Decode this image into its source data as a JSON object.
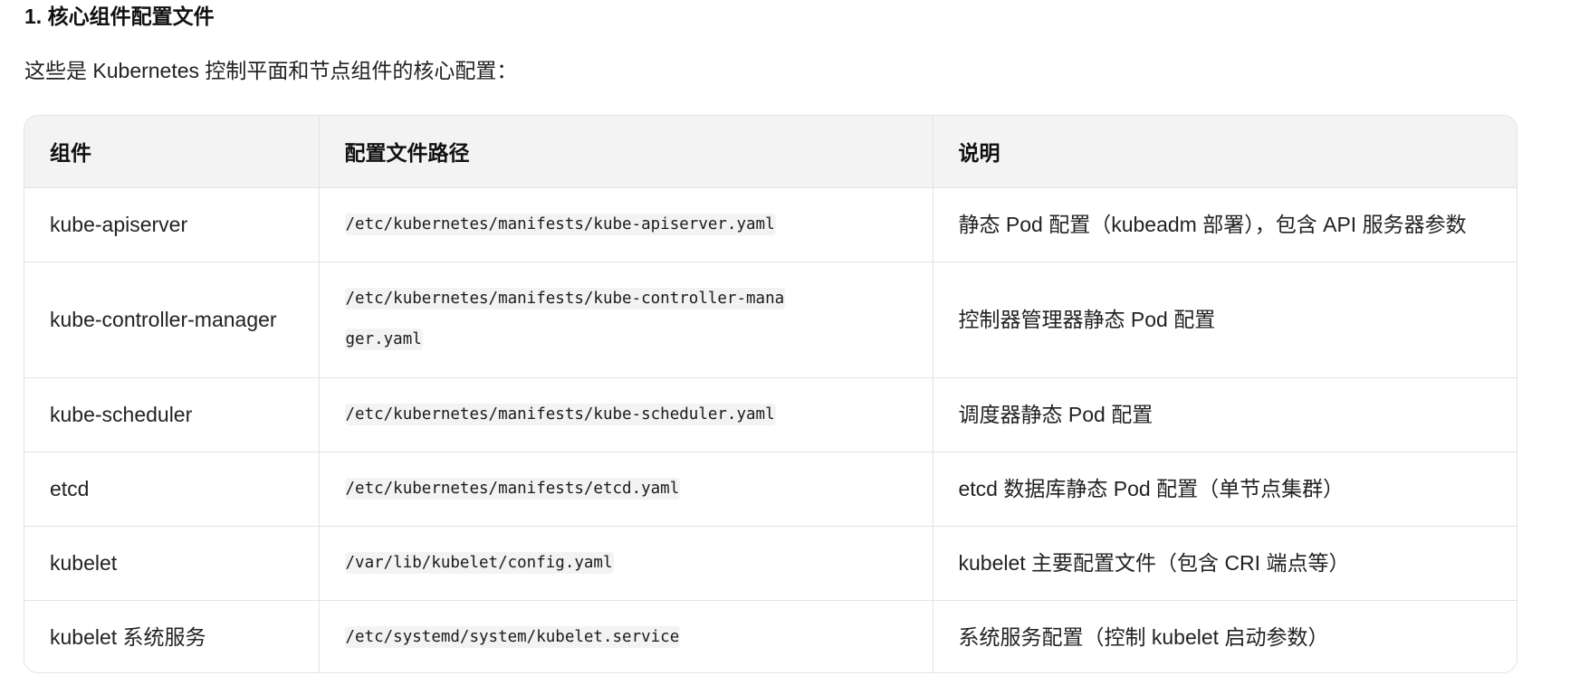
{
  "heading": "1. 核心组件配置文件",
  "intro": "这些是 Kubernetes 控制平面和节点组件的核心配置：",
  "table": {
    "headers": [
      "组件",
      "配置文件路径",
      "说明"
    ],
    "rows": [
      {
        "component": "kube-apiserver",
        "path": "/etc/kubernetes/manifests/kube-apiserver.yaml",
        "desc": "静态 Pod 配置（kubeadm 部署），包含 API 服务器参数"
      },
      {
        "component": "kube-controller-manager",
        "path": "/etc/kubernetes/manifests/kube-controller-manager.yaml",
        "desc": "控制器管理器静态 Pod 配置"
      },
      {
        "component": "kube-scheduler",
        "path": "/etc/kubernetes/manifests/kube-scheduler.yaml",
        "desc": "调度器静态 Pod 配置"
      },
      {
        "component": "etcd",
        "path": "/etc/kubernetes/manifests/etcd.yaml",
        "desc": "etcd 数据库静态 Pod 配置（单节点集群）"
      },
      {
        "component": "kubelet",
        "path": "/var/lib/kubelet/config.yaml",
        "desc": "kubelet 主要配置文件（包含 CRI 端点等）"
      },
      {
        "component": "kubelet 系统服务",
        "path": "/etc/systemd/system/kubelet.service",
        "desc": "系统服务配置（控制 kubelet 启动参数）"
      }
    ]
  }
}
